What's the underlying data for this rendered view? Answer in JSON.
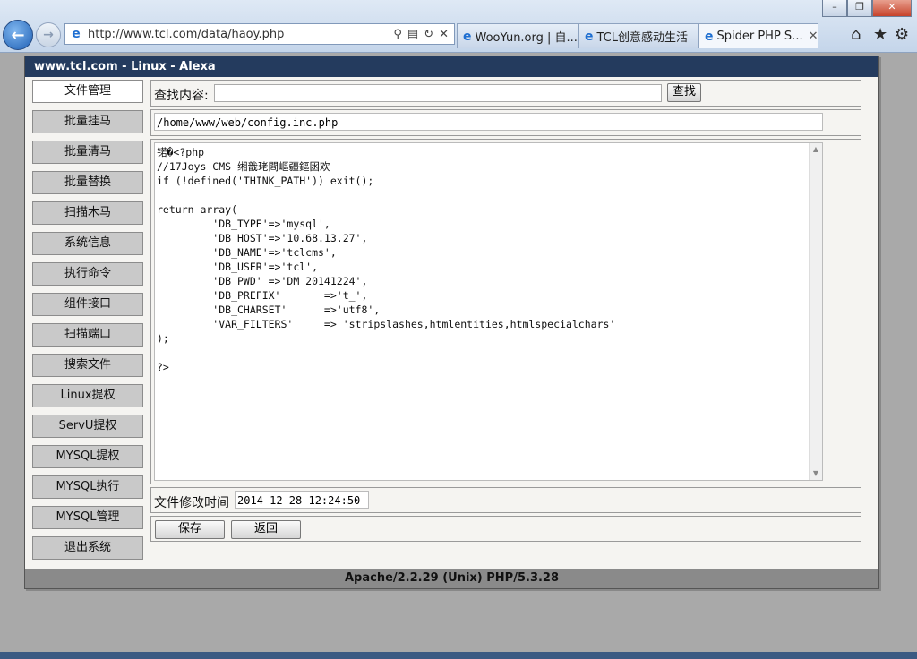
{
  "browser": {
    "address_url": "http://www.tcl.com/data/haoy.php",
    "tabs": [
      {
        "label": "WooYun.org | 自..."
      },
      {
        "label": "TCL创意感动生活"
      },
      {
        "label": "Spider PHP S..."
      }
    ]
  },
  "app": {
    "title": "www.tcl.com - Linux - Alexa",
    "footer": "Apache/2.2.29 (Unix) PHP/5.3.28"
  },
  "sidebar": {
    "items": [
      {
        "label": "文件管理"
      },
      {
        "label": "批量挂马"
      },
      {
        "label": "批量清马"
      },
      {
        "label": "批量替换"
      },
      {
        "label": "扫描木马"
      },
      {
        "label": "系统信息"
      },
      {
        "label": "执行命令"
      },
      {
        "label": "组件接口"
      },
      {
        "label": "扫描端口"
      },
      {
        "label": "搜索文件"
      },
      {
        "label": "Linux提权"
      },
      {
        "label": "ServU提权"
      },
      {
        "label": "MYSQL提权"
      },
      {
        "label": "MYSQL执行"
      },
      {
        "label": "MYSQL管理"
      },
      {
        "label": "退出系统"
      }
    ]
  },
  "search": {
    "label": "查找内容:",
    "value": "",
    "button": "查找"
  },
  "file": {
    "path": "/home/www/web/config.inc.php",
    "content": "锘�<?php\n//17Joys CMS 缃戠珯閰嶇疆鏂囦欢\nif (!defined('THINK_PATH')) exit();\n\nreturn array(\n         'DB_TYPE'=>'mysql',\n         'DB_HOST'=>'10.68.13.27',\n         'DB_NAME'=>'tclcms',\n         'DB_USER'=>'tcl',\n         'DB_PWD' =>'DM_20141224',\n         'DB_PREFIX'       =>'t_',\n         'DB_CHARSET'      =>'utf8',\n         'VAR_FILTERS'     => 'stripslashes,htmlentities,htmlspecialchars'\n);\n\n?>",
    "mtime_label": "文件修改时间",
    "mtime_value": "2014-12-28 12:24:50"
  },
  "actions": {
    "save": "保存",
    "back": "返回"
  }
}
